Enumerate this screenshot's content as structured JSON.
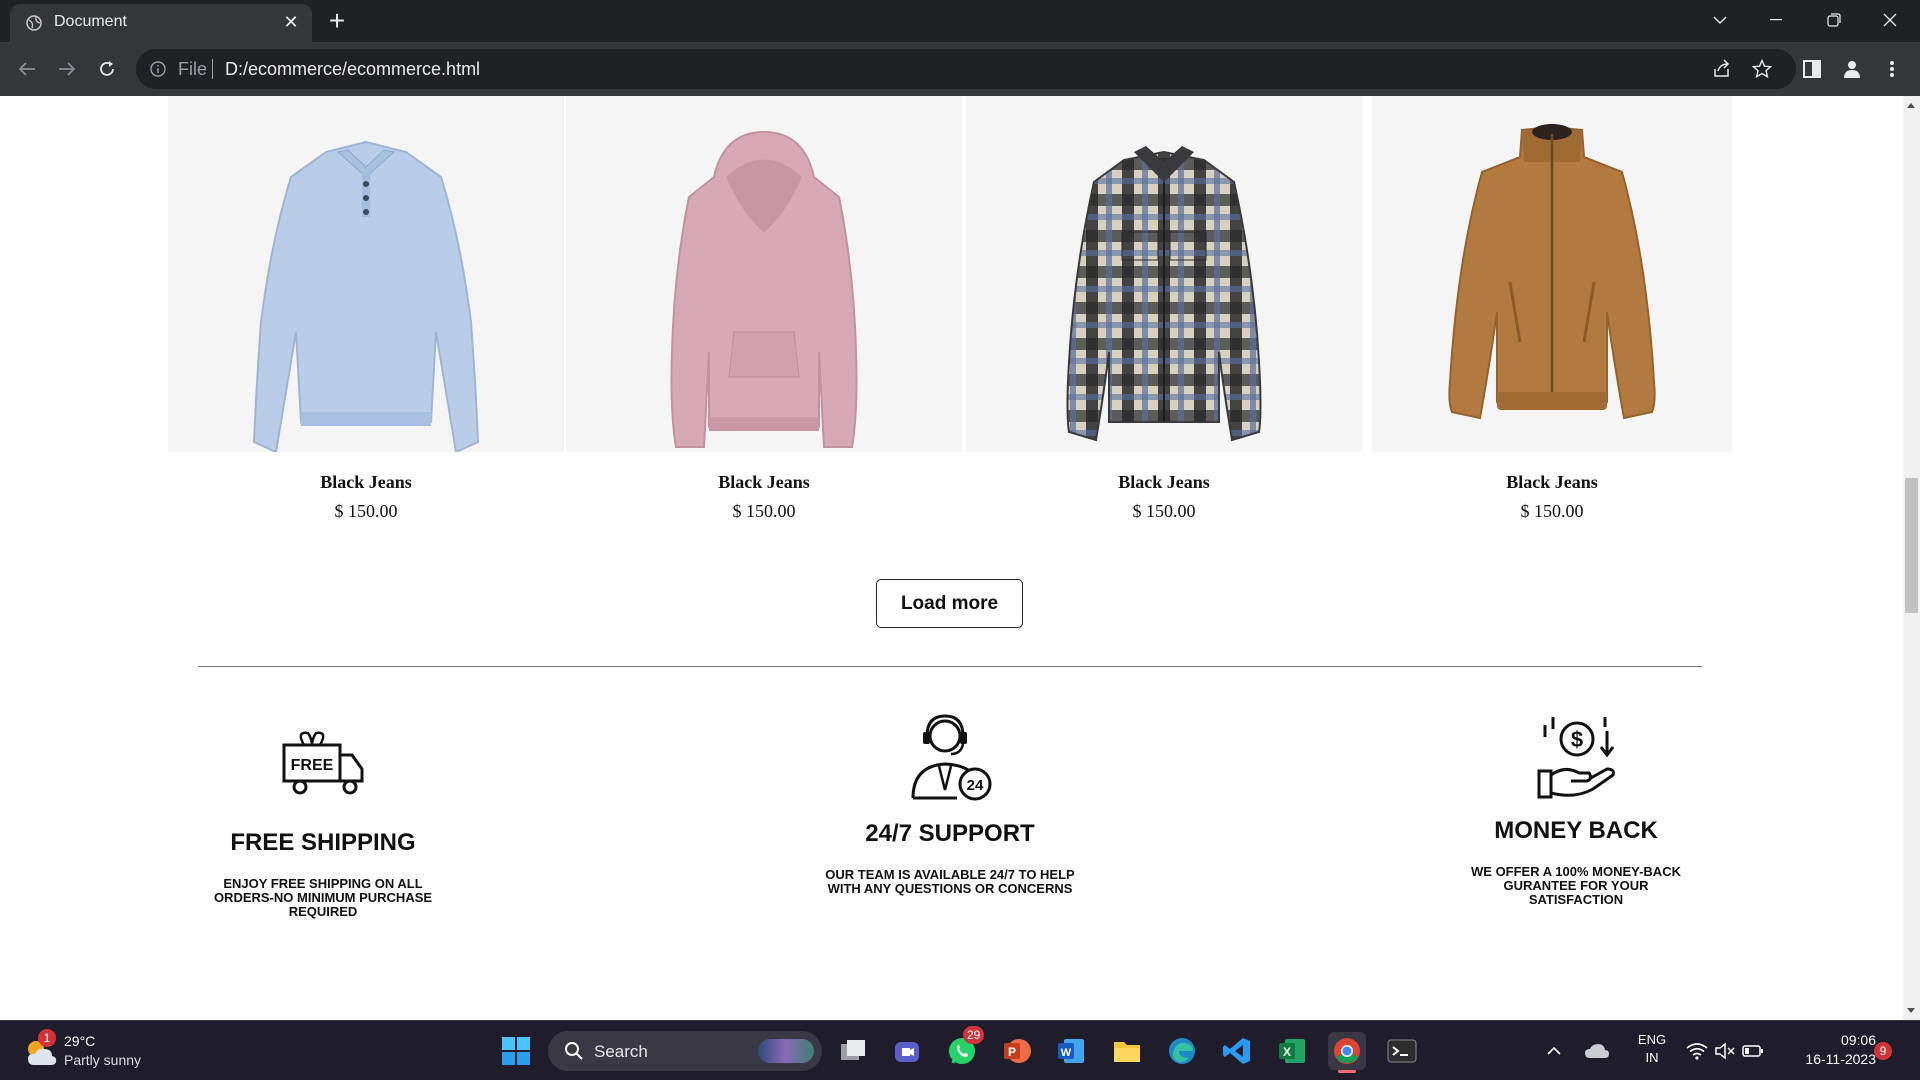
{
  "browser": {
    "tab_title": "Document",
    "url_scheme": "File",
    "url": "D:/ecommerce/ecommerce.html"
  },
  "products": [
    {
      "name": "Black Jeans",
      "price": "$ 150.00",
      "image": "light-blue-polo-sweater"
    },
    {
      "name": "Black Jeans",
      "price": "$ 150.00",
      "image": "pink-hoodie"
    },
    {
      "name": "Black Jeans",
      "price": "$ 150.00",
      "image": "plaid-flannel-shirt"
    },
    {
      "name": "Black Jeans",
      "price": "$ 150.00",
      "image": "brown-zip-jacket"
    }
  ],
  "load_more_label": "Load more",
  "features": [
    {
      "icon": "free-shipping-truck-icon",
      "title": "FREE SHIPPING",
      "description": "ENJOY FREE SHIPPING ON ALL ORDERS-NO MINIMUM PURCHASE REQUIRED",
      "icon_text": "FREE"
    },
    {
      "icon": "support-agent-icon",
      "title": "24/7 SUPPORT",
      "description": "OUR TEAM IS AVAILABLE 24/7 TO HELP WITH ANY QUESTIONS OR CONCERNS",
      "icon_text": "24"
    },
    {
      "icon": "money-back-icon",
      "title": "MONEY BACK",
      "description": "WE OFFER A 100% MONEY-BACK GURANTEE FOR YOUR SATISFACTION"
    }
  ],
  "taskbar": {
    "weather_temp": "29°C",
    "weather_desc": "Partly sunny",
    "weather_badge": "1",
    "search_label": "Search",
    "whatsapp_badge": "29",
    "lang_top": "ENG",
    "lang_bottom": "IN",
    "time": "09:06",
    "date": "16-11-2023",
    "notification_count": "9"
  },
  "colors": {
    "chrome_dark": "#202124",
    "chrome_toolbar": "#35363a",
    "taskbar": "#1f1c2c",
    "product_bg": "#f5f5f5"
  }
}
